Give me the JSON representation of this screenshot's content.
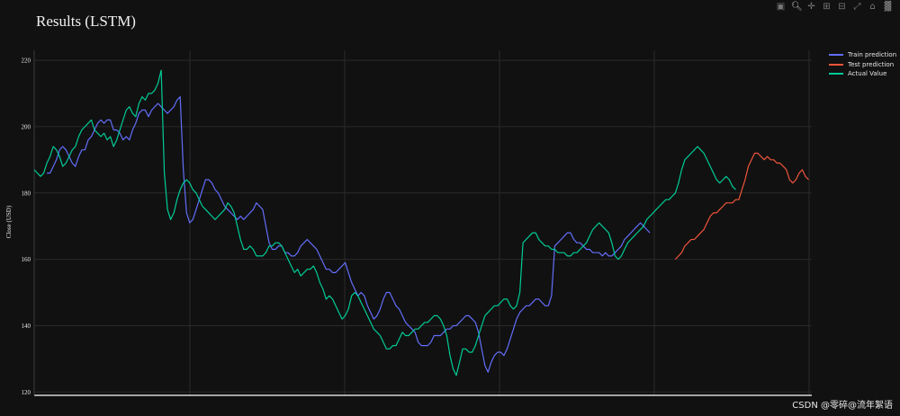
{
  "chart_data": {
    "type": "line",
    "title": "Results (LSTM)",
    "xlabel": "",
    "ylabel": "Close (USD)",
    "ylim": [
      119,
      223
    ],
    "y_ticks": [
      120,
      140,
      160,
      180,
      200,
      220
    ],
    "grid": true,
    "legend_position": "top-right",
    "series": [
      {
        "name": "Train prediction",
        "color": "#636efa",
        "x_start": 4,
        "x_step": 1,
        "values": [
          186,
          186,
          188,
          190,
          193,
          194,
          193,
          191,
          189,
          188,
          191,
          193,
          193,
          196,
          197,
          199,
          201,
          202,
          201,
          202,
          202,
          199,
          199,
          198,
          196,
          197,
          196,
          199,
          201,
          204,
          205,
          205,
          203,
          205,
          206,
          207,
          206,
          205,
          204,
          205,
          206,
          208,
          209,
          187,
          174,
          171,
          172,
          175,
          178,
          181,
          184,
          184,
          183,
          181,
          180,
          178,
          176,
          175,
          174,
          173,
          172,
          173,
          172,
          173,
          174,
          175,
          177,
          176,
          175,
          170,
          165,
          163,
          163,
          164,
          164,
          162,
          162,
          161,
          161,
          162,
          164,
          165,
          166,
          165,
          164,
          163,
          161,
          159,
          157,
          157,
          156,
          156,
          157,
          158,
          159,
          156,
          153,
          151,
          149,
          150,
          149,
          146,
          144,
          142,
          143,
          145,
          148,
          150,
          150,
          148,
          146,
          145,
          143,
          141,
          140,
          139,
          138,
          135,
          134,
          134,
          134,
          135,
          137,
          137,
          137,
          138,
          139,
          139,
          140,
          140,
          141,
          142,
          143,
          143,
          142,
          141,
          138,
          133,
          128,
          126,
          129,
          131,
          132,
          132,
          131,
          133,
          136,
          139,
          142,
          144,
          145,
          146,
          146,
          147,
          148,
          148,
          147,
          146,
          146,
          149,
          164,
          165,
          166,
          167,
          168,
          168,
          166,
          165,
          165,
          164,
          163,
          163,
          162,
          162,
          162,
          161,
          162,
          161,
          161,
          162,
          163,
          164,
          166,
          167,
          168,
          169,
          170,
          171,
          170,
          169,
          168
        ]
      },
      {
        "name": "Test prediction",
        "color": "#ef553b",
        "x_start": 202,
        "x_step": 1,
        "values": [
          160,
          161,
          162,
          164,
          165,
          166,
          166,
          167,
          168,
          169,
          171,
          173,
          174,
          174,
          175,
          176,
          177,
          177,
          177,
          178,
          178,
          181,
          184,
          188,
          190,
          192,
          192,
          191,
          190,
          191,
          190,
          190,
          189,
          189,
          188,
          187,
          184,
          183,
          184,
          186,
          187,
          185,
          184
        ]
      },
      {
        "name": "Actual Value",
        "color": "#00cc96",
        "x_start": 0,
        "x_step": 1,
        "values": [
          187,
          186,
          185,
          186,
          189,
          191,
          194,
          193,
          191,
          188,
          189,
          191,
          193,
          194,
          197,
          199,
          200,
          201,
          202,
          199,
          198,
          197,
          198,
          196,
          197,
          194,
          196,
          199,
          202,
          205,
          206,
          204,
          203,
          207,
          209,
          208,
          210,
          210,
          211,
          213,
          217,
          186,
          175,
          172,
          174,
          178,
          181,
          183,
          184,
          183,
          181,
          180,
          178,
          176,
          175,
          174,
          173,
          172,
          173,
          174,
          175,
          177,
          176,
          174,
          170,
          166,
          163,
          163,
          164,
          163,
          161,
          161,
          161,
          162,
          164,
          164,
          165,
          165,
          164,
          162,
          160,
          158,
          156,
          157,
          155,
          156,
          157,
          157,
          158,
          156,
          153,
          151,
          148,
          149,
          148,
          146,
          144,
          142,
          143,
          145,
          149,
          150,
          149,
          147,
          145,
          143,
          141,
          139,
          138,
          137,
          135,
          133,
          133,
          134,
          134,
          136,
          138,
          137,
          137,
          138,
          139,
          139,
          140,
          141,
          141,
          142,
          143,
          143,
          142,
          140,
          137,
          131,
          127,
          125,
          129,
          133,
          133,
          132,
          132,
          134,
          137,
          140,
          143,
          144,
          145,
          146,
          146,
          147,
          148,
          148,
          146,
          145,
          146,
          150,
          165,
          166,
          167,
          168,
          168,
          166,
          165,
          164,
          164,
          163,
          163,
          162,
          162,
          162,
          161,
          161,
          162,
          162,
          163,
          164,
          165,
          167,
          169,
          170,
          171,
          170,
          169,
          168,
          165,
          161,
          160,
          161,
          163,
          165,
          166,
          167,
          168,
          169,
          170,
          172,
          173,
          174,
          175,
          176,
          177,
          178,
          178,
          179,
          180,
          183,
          187,
          190,
          191,
          192,
          193,
          194,
          193,
          192,
          190,
          188,
          186,
          184,
          183,
          184,
          185,
          184,
          182,
          181
        ]
      }
    ]
  },
  "watermark": "CSDN @零碎@流年絮语"
}
